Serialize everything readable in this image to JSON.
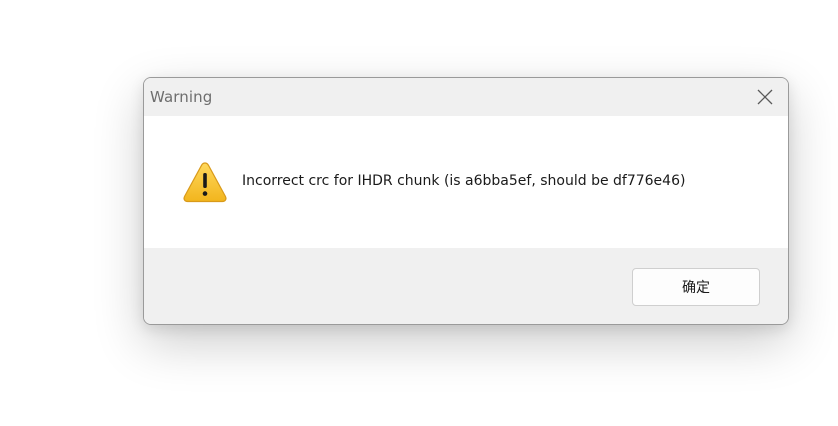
{
  "dialog": {
    "title": "Warning",
    "message": "Incorrect crc for IHDR chunk (is a6bba5ef, should be df776e46)",
    "icon": "warning-triangle-icon",
    "ok_label": "确定",
    "close_icon": "close-icon"
  },
  "colors": {
    "warning_fill": "#F7C744",
    "warning_stroke": "#D99A1A",
    "warning_glyph": "#1a1a1a",
    "titlebar_bg": "#f0f0f0",
    "content_bg": "#ffffff"
  }
}
